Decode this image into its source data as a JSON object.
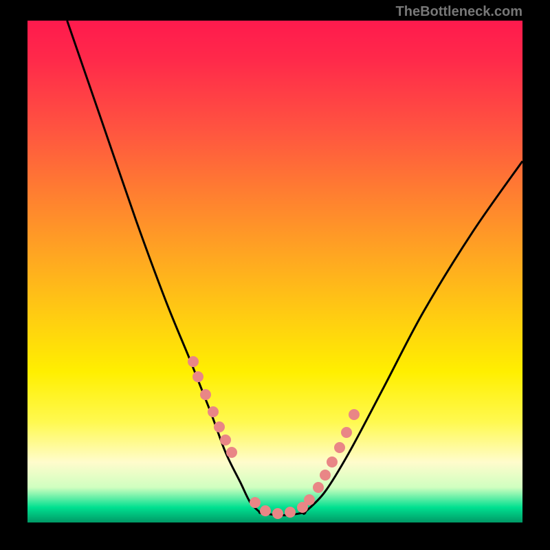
{
  "watermark": "TheBottleneck.com",
  "chart_data": {
    "type": "line",
    "title": "",
    "xlabel": "",
    "ylabel": "",
    "xlim": [
      0,
      100
    ],
    "ylim": [
      0,
      100
    ],
    "note": "Axes are unlabeled in the source image; x/y values are estimated pixel-proportion percentages (0-100 each axis, origin bottom-left).",
    "series": [
      {
        "name": "left-descending-curve",
        "x": [
          8,
          15,
          22,
          28,
          33,
          37,
          40,
          43,
          45,
          47
        ],
        "y": [
          100,
          80,
          60,
          44,
          32,
          22,
          14,
          8,
          4,
          2
        ]
      },
      {
        "name": "valley-floor",
        "x": [
          47,
          50,
          53,
          56
        ],
        "y": [
          2,
          1.5,
          1.5,
          2
        ]
      },
      {
        "name": "right-ascending-curve",
        "x": [
          56,
          60,
          65,
          72,
          80,
          90,
          100
        ],
        "y": [
          2,
          6,
          14,
          27,
          42,
          58,
          72
        ]
      }
    ],
    "scatter_points": {
      "name": "highlight-dots",
      "x": [
        33.5,
        34.5,
        36,
        37.5,
        38.8,
        40,
        41.2,
        46,
        48,
        50.5,
        53,
        55.5,
        57,
        58.8,
        60.2,
        61.5,
        63,
        64.5,
        66
      ],
      "y": [
        32,
        29,
        25.5,
        22,
        19,
        16.5,
        14,
        4,
        2.3,
        1.8,
        2,
        3,
        4.5,
        7,
        9.5,
        12,
        15,
        18,
        21.5
      ]
    },
    "background_gradient": {
      "type": "vertical",
      "stops": [
        {
          "pos": 0,
          "color": "#ff1a4d"
        },
        {
          "pos": 50,
          "color": "#ffc010"
        },
        {
          "pos": 78,
          "color": "#fff300"
        },
        {
          "pos": 90,
          "color": "#fffcd0"
        },
        {
          "pos": 100,
          "color": "#00b070"
        }
      ]
    }
  }
}
